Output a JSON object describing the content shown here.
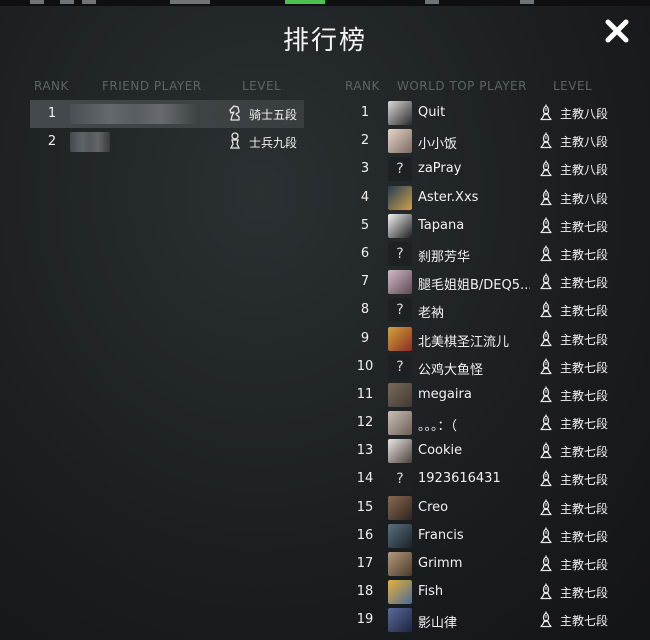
{
  "title": "排行榜",
  "icons": {
    "close": "close-x-icon",
    "pawn": "pawn-icon",
    "knight": "knight-icon",
    "bishop": "bishop-icon"
  },
  "friends": {
    "headers": {
      "rank": "RANK",
      "player": "FRIEND PLAYER",
      "level": "LEVEL"
    },
    "rows": [
      {
        "rank": "1",
        "level": "骑士五段",
        "icon": "knight",
        "selected": true
      },
      {
        "rank": "2",
        "level": "士兵九段",
        "icon": "pawn",
        "selected": false
      }
    ]
  },
  "world": {
    "headers": {
      "rank": "RANK",
      "player": "WORLD TOP PLAYER",
      "level": "LEVEL"
    },
    "rows": [
      {
        "rank": "1",
        "name": "Quit",
        "level": "主教八段",
        "avatar": [
          "#d9d9d9",
          "#2b2b2b"
        ]
      },
      {
        "rank": "2",
        "name": "小小饭",
        "level": "主教八段",
        "avatar": [
          "#e8d7c8",
          "#7a6a62"
        ]
      },
      {
        "rank": "3",
        "name": "zaPray",
        "level": "主教八段",
        "avatar": null
      },
      {
        "rank": "4",
        "name": "Aster.Xxs",
        "level": "主教八段",
        "avatar": [
          "#2a3b55",
          "#c9a24a"
        ]
      },
      {
        "rank": "5",
        "name": "Tapana",
        "level": "主教七段",
        "avatar": [
          "#f2f2f2",
          "#1e1e1e"
        ]
      },
      {
        "rank": "6",
        "name": "刹那芳华",
        "level": "主教七段",
        "avatar": null
      },
      {
        "rank": "7",
        "name": "腿毛姐姐B/DEQ5...",
        "level": "主教七段",
        "avatar": [
          "#d6b8c8",
          "#5a4a55"
        ]
      },
      {
        "rank": "8",
        "name": "老衲",
        "level": "主教七段",
        "avatar": null
      },
      {
        "rank": "9",
        "name": "北美棋圣江流儿",
        "level": "主教七段",
        "avatar": [
          "#d2a43a",
          "#8e2b24"
        ]
      },
      {
        "rank": "10",
        "name": "公鸡大鱼怪",
        "level": "主教七段",
        "avatar": null
      },
      {
        "rank": "11",
        "name": "megaira",
        "level": "主教七段",
        "avatar": [
          "#7b6a58",
          "#3f3a35"
        ]
      },
      {
        "rank": "12",
        "name": "。。。：（",
        "level": "主教七段",
        "avatar": [
          "#c9c0b6",
          "#6e5e55"
        ]
      },
      {
        "rank": "13",
        "name": "Cookie",
        "level": "主教七段",
        "avatar": [
          "#eae6e2",
          "#4a3e3a"
        ]
      },
      {
        "rank": "14",
        "name": "1923616431",
        "level": "主教七段",
        "avatar": null
      },
      {
        "rank": "15",
        "name": "Creo",
        "level": "主教七段",
        "avatar": [
          "#8a6a50",
          "#2e2420"
        ]
      },
      {
        "rank": "16",
        "name": "Francis",
        "level": "主教七段",
        "avatar": [
          "#5a7080",
          "#1c2228"
        ]
      },
      {
        "rank": "17",
        "name": "Grimm",
        "level": "主教七段",
        "avatar": [
          "#b59a7a",
          "#4a3a2e"
        ]
      },
      {
        "rank": "18",
        "name": "Fish",
        "level": "主教七段",
        "avatar": [
          "#e6b23a",
          "#4a6a9a"
        ]
      },
      {
        "rank": "19",
        "name": "影山律",
        "level": "主教七段",
        "avatar": [
          "#5a6a9a",
          "#1e2440"
        ]
      }
    ]
  }
}
